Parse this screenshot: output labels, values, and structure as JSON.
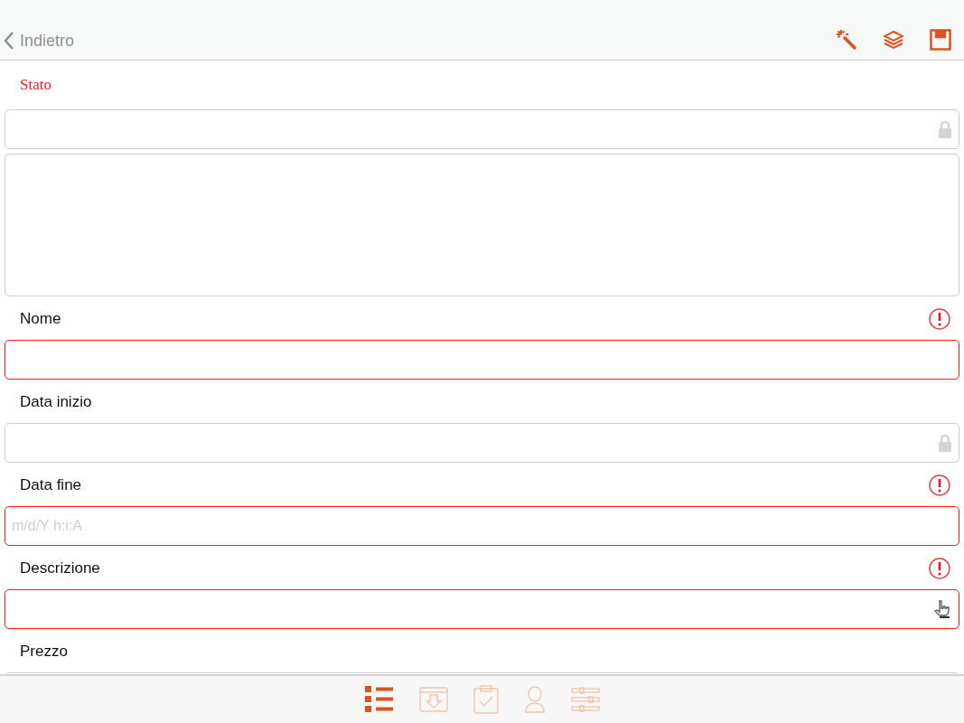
{
  "nav": {
    "back": "Indietro",
    "actions": [
      {
        "kind": "wand"
      },
      {
        "kind": "layers"
      },
      {
        "kind": "save"
      }
    ]
  },
  "fields": [
    {
      "label": "Stato",
      "kind": "heading",
      "required": false,
      "inputs": [
        {
          "kind": "text",
          "locked": true
        },
        {
          "kind": "textarea"
        }
      ]
    },
    {
      "label": "Nome",
      "kind": "field",
      "required": true,
      "inputs": [
        {
          "kind": "text",
          "locked": false
        }
      ]
    },
    {
      "label": "Data inizio",
      "kind": "field",
      "required": false,
      "inputs": [
        {
          "kind": "text",
          "locked": true
        }
      ]
    },
    {
      "label": "Data fine",
      "kind": "field",
      "required": true,
      "inputs": [
        {
          "kind": "text",
          "locked": false,
          "placeholder": "m/d/Y h:i:A"
        }
      ]
    },
    {
      "label": "Descrizione",
      "kind": "field",
      "required": true,
      "inputs": [
        {
          "kind": "picker",
          "locked": false
        }
      ]
    },
    {
      "label": "Prezzo",
      "kind": "field",
      "required": false,
      "inputs": [
        {
          "kind": "text"
        }
      ]
    }
  ],
  "tabs": [
    {
      "kind": "list",
      "selected": true
    },
    {
      "kind": "inbox",
      "selected": false
    },
    {
      "kind": "clipboard",
      "selected": false
    },
    {
      "kind": "person",
      "selected": false
    },
    {
      "kind": "sliders",
      "selected": false
    }
  ]
}
